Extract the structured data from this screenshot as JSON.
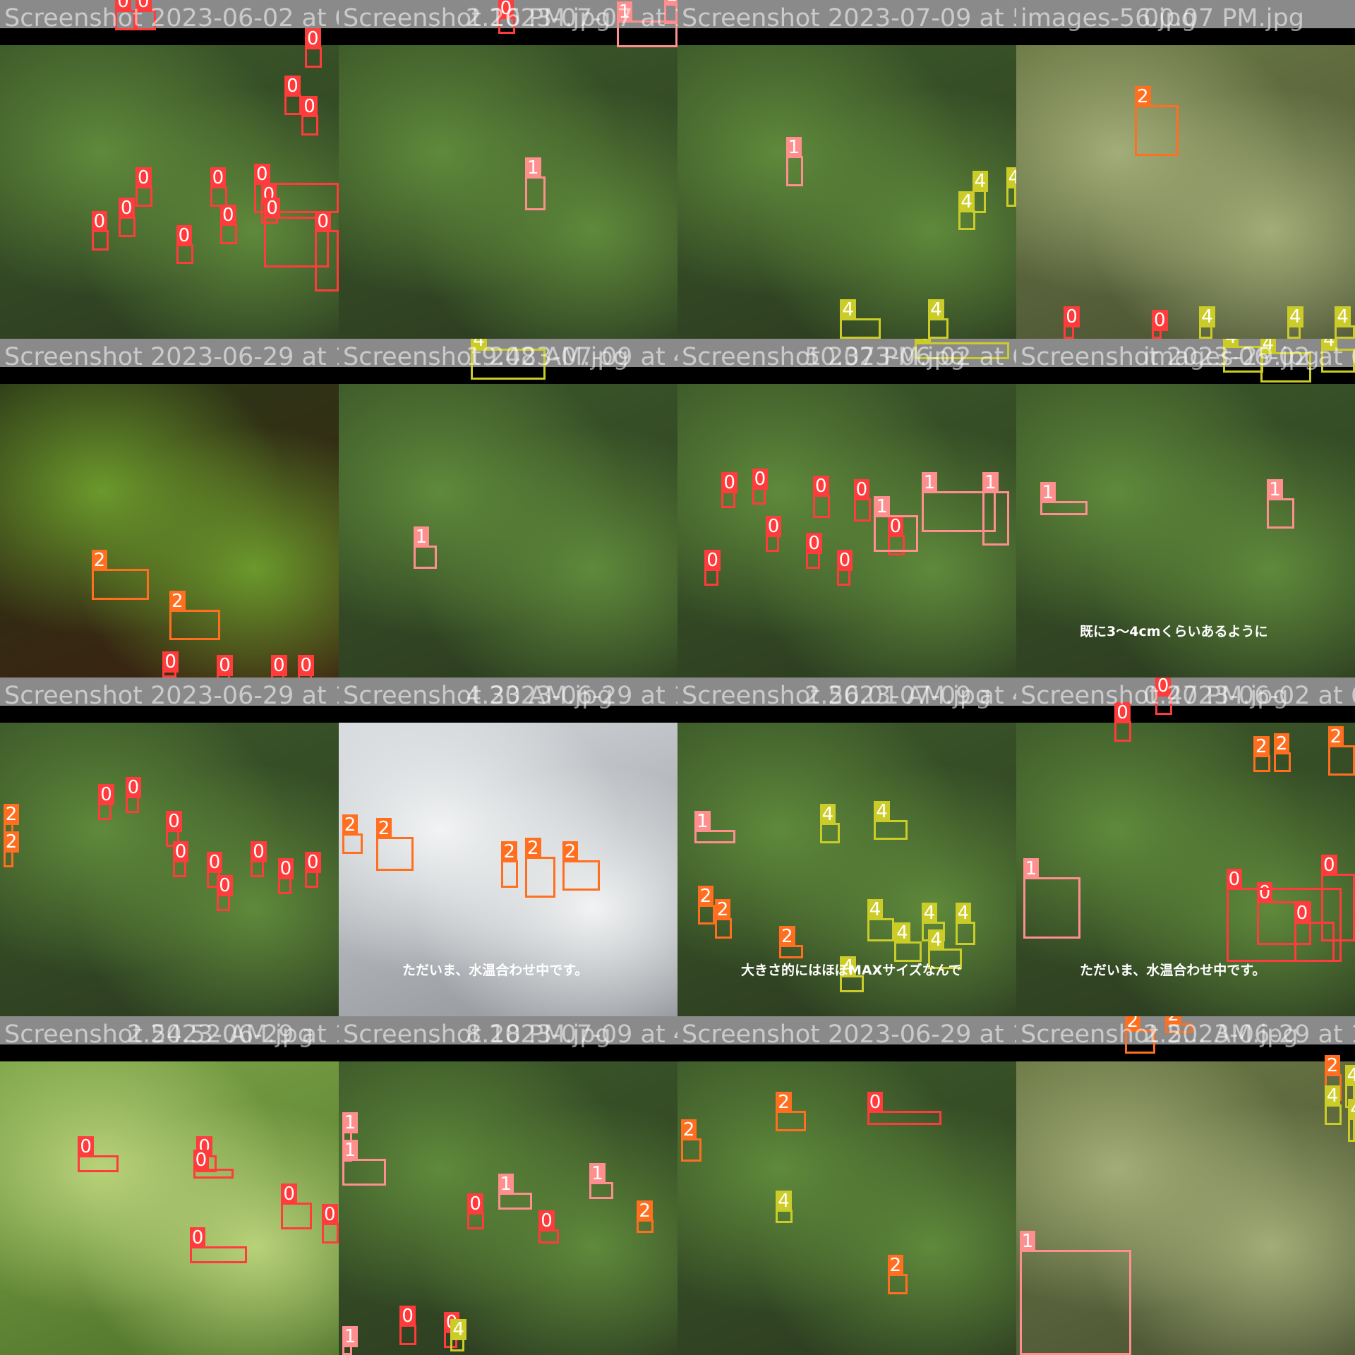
{
  "class_colors": {
    "0": "#ff3b3b",
    "1": "#ff8f8f",
    "2": "#ff6f1f",
    "4": "#cccc28"
  },
  "tiles": [
    {
      "title": "Screenshot 2023-06-02 at 6.",
      "tone": "green",
      "overlay_titles": [],
      "boxes": [
        [
          "0",
          0.34,
          0.03,
          0.06,
          0.06
        ],
        [
          "0",
          0.4,
          0.03,
          0.06,
          0.06
        ],
        [
          "0",
          0.9,
          0.14,
          0.05,
          0.06
        ],
        [
          "0",
          0.84,
          0.28,
          0.05,
          0.06
        ],
        [
          "0",
          0.89,
          0.34,
          0.05,
          0.06
        ],
        [
          "0",
          0.4,
          0.55,
          0.05,
          0.06
        ],
        [
          "0",
          0.62,
          0.55,
          0.05,
          0.06
        ],
        [
          "0",
          0.27,
          0.68,
          0.05,
          0.06
        ],
        [
          "0",
          0.35,
          0.64,
          0.05,
          0.06
        ],
        [
          "0",
          0.52,
          0.72,
          0.05,
          0.06
        ],
        [
          "0",
          0.65,
          0.66,
          0.05,
          0.06
        ],
        [
          "0",
          0.77,
          0.6,
          0.05,
          0.06
        ],
        [
          "0",
          0.75,
          0.54,
          0.25,
          0.09
        ],
        [
          "0",
          0.78,
          0.64,
          0.19,
          0.15
        ],
        [
          "0",
          0.93,
          0.68,
          0.07,
          0.18
        ]
      ],
      "captions": []
    },
    {
      "title": "Screenshot 2023-07-07 at 1",
      "tone": "green",
      "overlay_titles": [
        "2.16 PM.jpg"
      ],
      "boxes": [
        [
          "0",
          0.47,
          0.05,
          0.05,
          0.05
        ],
        [
          "1",
          0.96,
          0.01,
          0.04,
          0.06
        ],
        [
          "1",
          0.82,
          0.06,
          0.18,
          0.08
        ],
        [
          "1",
          0.55,
          0.52,
          0.06,
          0.1
        ]
      ],
      "captions": []
    },
    {
      "title": "Screenshot 2023-07-09 at 5.",
      "tone": "green",
      "overlay_titles": [],
      "boxes": [
        [
          "1",
          0.32,
          0.46,
          0.05,
          0.09
        ],
        [
          "4",
          0.87,
          0.56,
          0.04,
          0.07
        ],
        [
          "4",
          0.83,
          0.62,
          0.05,
          0.06
        ],
        [
          "4",
          0.97,
          0.55,
          0.03,
          0.06
        ],
        [
          "4",
          0.48,
          0.94,
          0.12,
          0.06
        ],
        [
          "4",
          0.74,
          0.94,
          0.06,
          0.06
        ]
      ],
      "captions": []
    },
    {
      "title": "images-56.jpg",
      "tone": "olive",
      "overlay_titles": [
        "00.07 PM.jpg"
      ],
      "boxes": [
        [
          "2",
          0.35,
          0.31,
          0.13,
          0.15
        ],
        [
          "0",
          0.14,
          0.96,
          0.03,
          0.04
        ],
        [
          "0",
          0.4,
          0.97,
          0.03,
          0.03
        ],
        [
          "4",
          0.54,
          0.96,
          0.04,
          0.04
        ],
        [
          "4",
          0.8,
          0.96,
          0.04,
          0.04
        ],
        [
          "4",
          0.94,
          0.96,
          0.06,
          0.04
        ]
      ],
      "captions": []
    },
    {
      "title": "Screenshot 2023-06-29 at 1.",
      "tone": "dark",
      "overlay_titles": [],
      "boxes": [
        [
          "2",
          0.27,
          0.68,
          0.17,
          0.09
        ],
        [
          "2",
          0.5,
          0.8,
          0.15,
          0.09
        ],
        [
          "0",
          0.48,
          0.98,
          0.04,
          0.02
        ],
        [
          "0",
          0.64,
          0.99,
          0.04,
          0.01
        ],
        [
          "0",
          0.8,
          0.99,
          0.04,
          0.01
        ],
        [
          "0",
          0.88,
          0.99,
          0.04,
          0.01
        ]
      ],
      "captions": []
    },
    {
      "title": "Screenshot 2023-07-09 at 4.",
      "tone": "green",
      "overlay_titles": [
        "19.48 AM.jpg"
      ],
      "boxes": [
        [
          "4",
          0.39,
          0.03,
          0.22,
          0.09
        ],
        [
          "1",
          0.22,
          0.61,
          0.07,
          0.07
        ]
      ],
      "captions": []
    },
    {
      "title": "Screenshot 2023-06-02 at 6.",
      "tone": "green",
      "overlay_titles": [
        "50.37 PM.jpg"
      ],
      "boxes": [
        [
          "0",
          0.13,
          0.45,
          0.04,
          0.05
        ],
        [
          "0",
          0.22,
          0.44,
          0.04,
          0.05
        ],
        [
          "0",
          0.4,
          0.46,
          0.05,
          0.07
        ],
        [
          "0",
          0.52,
          0.47,
          0.05,
          0.07
        ],
        [
          "0",
          0.26,
          0.58,
          0.04,
          0.05
        ],
        [
          "0",
          0.08,
          0.68,
          0.04,
          0.05
        ],
        [
          "0",
          0.38,
          0.63,
          0.04,
          0.05
        ],
        [
          "0",
          0.47,
          0.68,
          0.04,
          0.05
        ],
        [
          "0",
          0.62,
          0.58,
          0.05,
          0.06
        ],
        [
          "1",
          0.58,
          0.52,
          0.13,
          0.11
        ],
        [
          "1",
          0.72,
          0.45,
          0.22,
          0.12
        ],
        [
          "1",
          0.9,
          0.45,
          0.08,
          0.16
        ],
        [
          "4",
          0.7,
          0.01,
          0.28,
          0.05
        ]
      ],
      "captions": []
    },
    {
      "title": "Screenshot 2023-06-02 at 6.",
      "tone": "green",
      "overlay_titles": [
        "images-29.jpg"
      ],
      "boxes": [
        [
          "4",
          0.61,
          0.02,
          0.12,
          0.08
        ],
        [
          "4",
          0.72,
          0.04,
          0.15,
          0.09
        ],
        [
          "4",
          0.9,
          0.03,
          0.1,
          0.07
        ],
        [
          "1",
          0.07,
          0.48,
          0.14,
          0.04
        ],
        [
          "1",
          0.74,
          0.47,
          0.08,
          0.09
        ]
      ],
      "captions": [
        "既に3～4cmくらいあるように"
      ]
    },
    {
      "title": "Screenshot 2023-06-29 at 1.",
      "tone": "green",
      "overlay_titles": [],
      "boxes": [
        [
          "0",
          0.29,
          0.37,
          0.04,
          0.05
        ],
        [
          "0",
          0.37,
          0.35,
          0.04,
          0.05
        ],
        [
          "0",
          0.49,
          0.45,
          0.04,
          0.05
        ],
        [
          "0",
          0.51,
          0.54,
          0.04,
          0.05
        ],
        [
          "0",
          0.61,
          0.57,
          0.04,
          0.05
        ],
        [
          "0",
          0.64,
          0.64,
          0.04,
          0.05
        ],
        [
          "0",
          0.74,
          0.54,
          0.04,
          0.05
        ],
        [
          "0",
          0.82,
          0.59,
          0.04,
          0.05
        ],
        [
          "0",
          0.9,
          0.57,
          0.04,
          0.05
        ],
        [
          "2",
          0.01,
          0.43,
          0.03,
          0.05
        ],
        [
          "2",
          0.01,
          0.51,
          0.03,
          0.05
        ]
      ],
      "captions": []
    },
    {
      "title": "Screenshot 2023-06-29 at 1",
      "tone": "pale",
      "overlay_titles": [
        "4.33 AM.jpg"
      ],
      "boxes": [
        [
          "2",
          0.01,
          0.46,
          0.06,
          0.06
        ],
        [
          "2",
          0.11,
          0.47,
          0.11,
          0.1
        ],
        [
          "2",
          0.48,
          0.54,
          0.05,
          0.08
        ],
        [
          "2",
          0.55,
          0.53,
          0.09,
          0.12
        ],
        [
          "2",
          0.66,
          0.54,
          0.11,
          0.09
        ]
      ],
      "captions": [
        "ただいま、水温合わせ中です。"
      ]
    },
    {
      "title": "Screenshot 2023-07-09 at 4.",
      "tone": "green",
      "overlay_titles": [
        "2.56.01 AM.jpg"
      ],
      "boxes": [
        [
          "1",
          0.05,
          0.45,
          0.12,
          0.04
        ],
        [
          "4",
          0.42,
          0.43,
          0.06,
          0.06
        ],
        [
          "4",
          0.58,
          0.42,
          0.1,
          0.06
        ],
        [
          "2",
          0.06,
          0.67,
          0.05,
          0.06
        ],
        [
          "2",
          0.11,
          0.71,
          0.05,
          0.06
        ],
        [
          "2",
          0.3,
          0.79,
          0.07,
          0.04
        ],
        [
          "4",
          0.56,
          0.71,
          0.08,
          0.07
        ],
        [
          "4",
          0.72,
          0.72,
          0.07,
          0.06
        ],
        [
          "4",
          0.82,
          0.72,
          0.06,
          0.07
        ],
        [
          "4",
          0.64,
          0.78,
          0.08,
          0.06
        ],
        [
          "4",
          0.74,
          0.8,
          0.1,
          0.06
        ],
        [
          "4",
          0.48,
          0.88,
          0.07,
          0.05
        ]
      ],
      "captions": [
        "大きさ的にはほぼMAXサイズなんで"
      ]
    },
    {
      "title": "Screenshot 2023-06-02 at 6",
      "tone": "green",
      "overlay_titles": [
        "0.47 PM.jpg"
      ],
      "boxes": [
        [
          "0",
          0.29,
          0.13,
          0.05,
          0.06
        ],
        [
          "0",
          0.41,
          0.05,
          0.05,
          0.06
        ],
        [
          "2",
          0.7,
          0.23,
          0.05,
          0.05
        ],
        [
          "2",
          0.76,
          0.22,
          0.05,
          0.06
        ],
        [
          "2",
          0.92,
          0.2,
          0.08,
          0.09
        ],
        [
          "1",
          0.02,
          0.59,
          0.17,
          0.18
        ],
        [
          "0",
          0.71,
          0.66,
          0.16,
          0.13
        ],
        [
          "0",
          0.62,
          0.62,
          0.34,
          0.22
        ],
        [
          "0",
          0.82,
          0.72,
          0.12,
          0.12
        ],
        [
          "0",
          0.9,
          0.58,
          0.1,
          0.2
        ]
      ],
      "captions": [
        "ただいま、水温合わせ中です。"
      ]
    },
    {
      "title": "Screenshot 2023-06-29 at 1",
      "tone": "bright",
      "overlay_titles": [
        "2.54.52 AM.jpg"
      ],
      "boxes": [
        [
          "0",
          0.23,
          0.41,
          0.12,
          0.05
        ],
        [
          "0",
          0.58,
          0.41,
          0.06,
          0.05
        ],
        [
          "0",
          0.57,
          0.45,
          0.12,
          0.03
        ],
        [
          "0",
          0.83,
          0.55,
          0.09,
          0.08
        ],
        [
          "0",
          0.56,
          0.68,
          0.17,
          0.05
        ],
        [
          "0",
          0.95,
          0.61,
          0.05,
          0.06
        ]
      ],
      "captions": []
    },
    {
      "title": "Screenshot 2023-07-09 at 4",
      "tone": "green",
      "overlay_titles": [
        "8.18 PM.jpg"
      ],
      "boxes": [
        [
          "1",
          0.01,
          0.34,
          0.03,
          0.09
        ],
        [
          "1",
          0.01,
          0.42,
          0.13,
          0.08
        ],
        [
          "0",
          0.38,
          0.58,
          0.05,
          0.05
        ],
        [
          "1",
          0.47,
          0.52,
          0.1,
          0.05
        ],
        [
          "0",
          0.59,
          0.63,
          0.06,
          0.04
        ],
        [
          "1",
          0.74,
          0.49,
          0.07,
          0.05
        ],
        [
          "2",
          0.88,
          0.6,
          0.05,
          0.04
        ],
        [
          "0",
          0.18,
          0.91,
          0.05,
          0.06
        ],
        [
          "0",
          0.31,
          0.93,
          0.04,
          0.05
        ],
        [
          "4",
          0.33,
          0.95,
          0.04,
          0.04
        ],
        [
          "1",
          0.01,
          0.97,
          0.03,
          0.03
        ]
      ],
      "captions": []
    },
    {
      "title": "Screenshot 2023-06-29 at 1.",
      "tone": "green",
      "overlay_titles": [],
      "boxes": [
        [
          "2",
          0.29,
          0.28,
          0.09,
          0.06
        ],
        [
          "2",
          0.01,
          0.36,
          0.06,
          0.07
        ],
        [
          "0",
          0.56,
          0.28,
          0.22,
          0.04
        ],
        [
          "4",
          0.29,
          0.57,
          0.05,
          0.04
        ],
        [
          "2",
          0.62,
          0.76,
          0.06,
          0.06
        ]
      ],
      "captions": []
    },
    {
      "title": "Screenshot 2023-06-29 at 1",
      "tone": "olive",
      "overlay_titles": [
        "2.5... AM.jpg"
      ],
      "boxes": [
        [
          "2",
          0.32,
          0.04,
          0.09,
          0.07
        ],
        [
          "2",
          0.44,
          0.02,
          0.08,
          0.03
        ],
        [
          "2",
          0.91,
          0.17,
          0.05,
          0.08
        ],
        [
          "4",
          0.91,
          0.26,
          0.05,
          0.06
        ],
        [
          "4",
          0.97,
          0.2,
          0.03,
          0.07
        ],
        [
          "4",
          0.98,
          0.3,
          0.02,
          0.07
        ],
        [
          "1",
          0.01,
          0.69,
          0.33,
          0.31
        ]
      ],
      "captions": []
    }
  ]
}
